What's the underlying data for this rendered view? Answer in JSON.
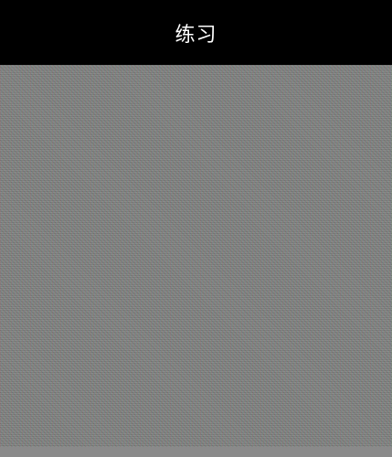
{
  "header": {
    "title": "练习"
  },
  "colors": {
    "header_background": "#000000",
    "title_text": "#ffffff",
    "content_background": "#808080"
  }
}
